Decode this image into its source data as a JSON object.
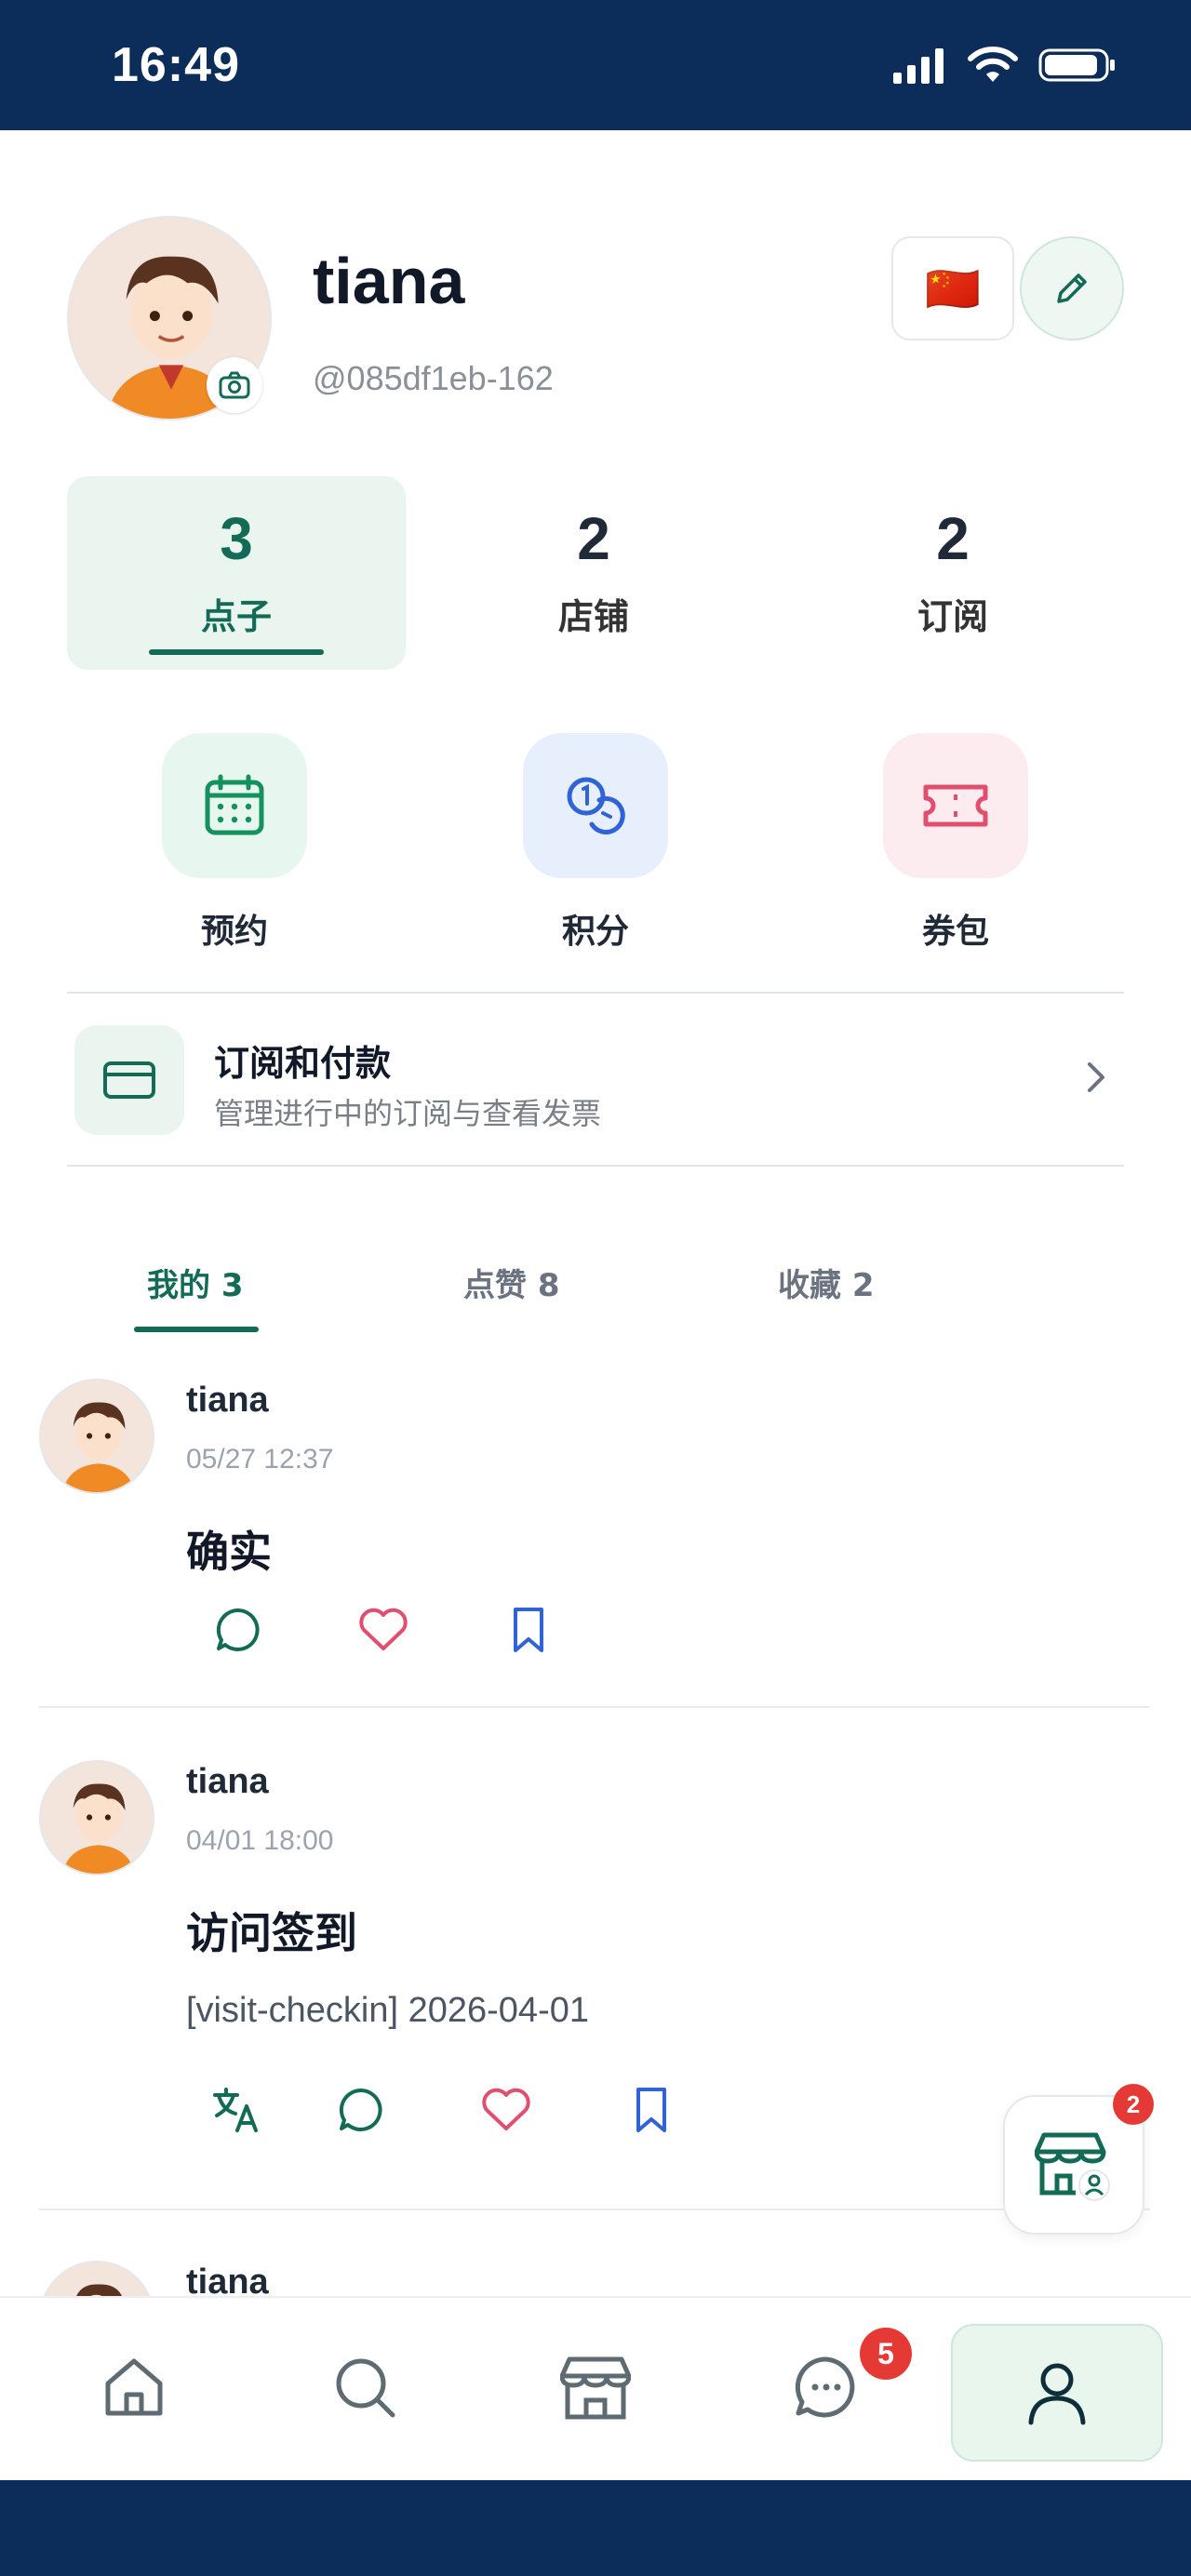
{
  "status_bar": {
    "time": "16:49"
  },
  "profile": {
    "name": "tiana",
    "handle": "@085df1eb-162",
    "flag": "🇨🇳"
  },
  "stats": [
    {
      "value": "3",
      "label": "点子"
    },
    {
      "value": "2",
      "label": "店铺"
    },
    {
      "value": "2",
      "label": "订阅"
    }
  ],
  "quick_actions": [
    {
      "label": "预约",
      "icon": "calendar-icon",
      "tile_color": "#e7f6ee",
      "icon_color": "#15915f"
    },
    {
      "label": "积分",
      "icon": "coins-icon",
      "tile_color": "#e8effc",
      "icon_color": "#2f63d6"
    },
    {
      "label": "券包",
      "icon": "ticket-icon",
      "tile_color": "#fdecef",
      "icon_color": "#e0506e"
    }
  ],
  "subscription": {
    "title": "订阅和付款",
    "description": "管理进行中的订阅与查看发票"
  },
  "tabs": [
    {
      "label": "我的 3"
    },
    {
      "label": "点赞 8"
    },
    {
      "label": "收藏 2"
    }
  ],
  "posts": [
    {
      "author": "tiana",
      "time": "05/27 12:37",
      "title": "确实",
      "body": ""
    },
    {
      "author": "tiana",
      "time": "04/01 18:00",
      "title": "访问签到",
      "body": "[visit-checkin] 2026-04-01"
    },
    {
      "author": "tiana"
    }
  ],
  "fab": {
    "badge": "2"
  },
  "bottom_nav": {
    "items": [
      "home-icon",
      "search-icon",
      "store-icon",
      "chat-icon",
      "profile-icon"
    ],
    "messages_badge": "5"
  },
  "colors": {
    "primary": "#136b55",
    "status_bar": "#0c2c5a",
    "like": "#e0506e",
    "bookmark": "#2f63d6",
    "badge": "#e53935"
  }
}
